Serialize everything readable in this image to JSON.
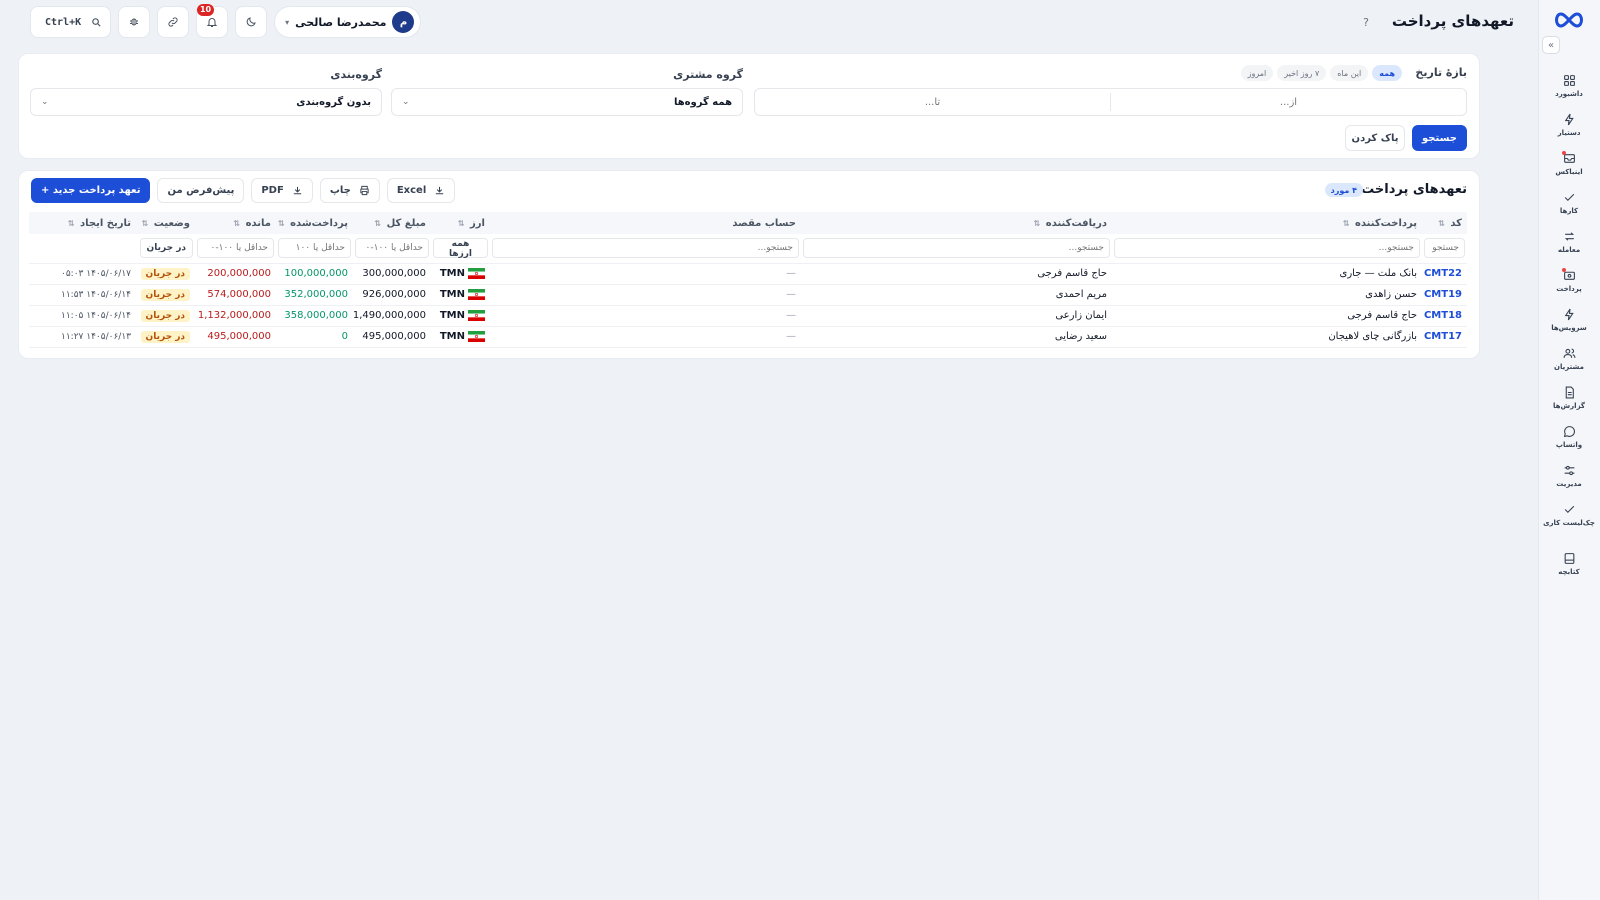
{
  "app": {
    "title": "تعهدهای پرداخت",
    "help_icon": "question-icon"
  },
  "sidebar": {
    "collapse_icon": "chevrons-right-icon",
    "items": [
      {
        "label": "داشبورد",
        "icon": "grid-icon"
      },
      {
        "label": "دستیار",
        "icon": "bolt-icon"
      },
      {
        "label": "اینباکس",
        "icon": "inbox-icon",
        "dot": true
      },
      {
        "label": "کارها",
        "icon": "check-icon"
      },
      {
        "label": "معامله",
        "icon": "exchange-icon"
      },
      {
        "label": "پرداخت",
        "icon": "wallet-icon",
        "dot": true
      },
      {
        "label": "سرویس‌ها",
        "icon": "lightning-icon"
      },
      {
        "label": "مشتریان",
        "icon": "users-icon"
      },
      {
        "label": "گزارش‌ها",
        "icon": "report-icon"
      },
      {
        "label": "واتساپ",
        "icon": "chat-icon"
      },
      {
        "label": "مدیریت",
        "icon": "sliders-icon"
      },
      {
        "label": "چک‌لیست کاری",
        "icon": "checklist-icon"
      },
      {
        "label": "کتابچه",
        "icon": "book-icon"
      }
    ]
  },
  "topbar": {
    "user_name": "محمدرضا صالحی",
    "avatar_initial": "م",
    "notifications_count": "10",
    "search_shortcut": "Ctrl+K"
  },
  "filters": {
    "date_range_label": "بازهٔ تاریخ",
    "presets": [
      "همه",
      "این ماه",
      "۷ روز اخیر",
      "امروز"
    ],
    "from_placeholder": "از...",
    "to_placeholder": "تا...",
    "customer_group_label": "گروه مشتری",
    "customer_group_value": "همه گروه‌ها",
    "grouping_label": "گروه‌بندی",
    "grouping_value": "بدون گروه‌بندی",
    "search_button": "جستجو",
    "clear_button": "پاک کردن"
  },
  "list": {
    "title": "تعهدهای پرداخت",
    "count_badge": "۴ مورد",
    "toolbar": {
      "excel": "Excel",
      "print": "چاپ",
      "pdf": "PDF",
      "my_default": "پیش‌فرض من",
      "new_commitment": "+ تعهد پرداخت جدید"
    },
    "columns": {
      "code": "کد",
      "payer": "پرداخت‌کننده",
      "payee": "دریافت‌کننده",
      "dest_account": "حساب مقصد",
      "currency": "ارز",
      "total": "مبلغ کل",
      "paid": "پرداخت‌شده",
      "remaining": "مانده",
      "status": "وضعیت",
      "created_at": "تاریخ ایجاد"
    },
    "column_filters": {
      "code_placeholder": "جستجو",
      "payer_placeholder": "جستجو...",
      "payee_placeholder": "جستجو...",
      "dest_placeholder": "جستجو...",
      "currency_value": "همه ارزها",
      "total_placeholder": "حداقل یا ۱۰۰-۰",
      "paid_placeholder": "حداقل یا ۱۰۰",
      "remaining_placeholder": "حداقل یا ۱۰۰-۰",
      "status_value": "در جریان"
    },
    "rows": [
      {
        "code": "CMT22",
        "payer": "بانک ملت — جاری",
        "payee": "حاج قاسم فرجی",
        "dest": "—",
        "currency": "TMN",
        "total": "300,000,000",
        "paid": "100,000,000",
        "remaining": "200,000,000",
        "status": "در جریان",
        "created": "۱۴۰۵/۰۶/۱۷ ۰۵:۰۳"
      },
      {
        "code": "CMT19",
        "payer": "حسن زاهدی",
        "payee": "مریم احمدی",
        "dest": "—",
        "currency": "TMN",
        "total": "926,000,000",
        "paid": "352,000,000",
        "remaining": "574,000,000",
        "status": "در جریان",
        "created": "۱۴۰۵/۰۶/۱۴ ۱۱:۵۳"
      },
      {
        "code": "CMT18",
        "payer": "حاج قاسم فرجی",
        "payee": "ایمان زارعی",
        "dest": "—",
        "currency": "TMN",
        "total": "1,490,000,000",
        "paid": "358,000,000",
        "remaining": "1,132,000,000",
        "status": "در جریان",
        "created": "۱۴۰۵/۰۶/۱۴ ۱۱:۰۵"
      },
      {
        "code": "CMT17",
        "payer": "بازرگانی چای لاهیجان",
        "payee": "سعید رضایی",
        "dest": "—",
        "currency": "TMN",
        "total": "495,000,000",
        "paid": "0",
        "remaining": "495,000,000",
        "status": "در جریان",
        "created": "۱۴۰۵/۰۶/۱۳ ۱۱:۲۷"
      }
    ]
  },
  "colors": {
    "primary": "#1d4ed8",
    "paid": "#059669",
    "remaining": "#b91c1c",
    "status_bg": "#fef3c7",
    "status_fg": "#b45309",
    "badge": "#dc2626"
  }
}
